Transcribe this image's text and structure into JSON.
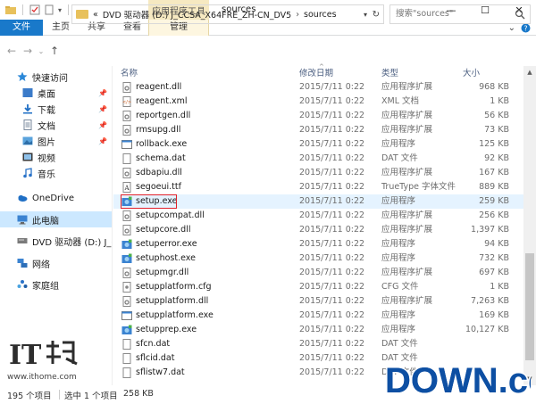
{
  "titlebar": {
    "context_group": "应用程序工具",
    "title": "sources",
    "minimize": "—",
    "maximize": "☐",
    "close": "✕"
  },
  "tabs": {
    "file": "文件",
    "home": "主页",
    "share": "共享",
    "view": "查看",
    "manage": "管理"
  },
  "address": {
    "overflow": "«",
    "path": [
      "DVD 驱动器 (D:) J_CCSA_X64FRE_ZH-CN_DV5",
      "sources"
    ],
    "search_placeholder": "搜索\"sources\""
  },
  "navpane": {
    "items": [
      {
        "label": "快速访问",
        "icon": "star-icon"
      },
      {
        "label": "桌面",
        "icon": "desktop-icon",
        "pinned": true
      },
      {
        "label": "下载",
        "icon": "download-icon",
        "pinned": true
      },
      {
        "label": "文档",
        "icon": "documents-icon",
        "pinned": true
      },
      {
        "label": "图片",
        "icon": "pictures-icon",
        "pinned": true
      },
      {
        "label": "视频",
        "icon": "videos-icon"
      },
      {
        "label": "音乐",
        "icon": "music-icon"
      },
      {
        "label": "OneDrive",
        "icon": "onedrive-icon"
      },
      {
        "label": "此电脑",
        "icon": "this-pc-icon",
        "selected": true
      },
      {
        "label": "DVD 驱动器 (D:) J_C",
        "icon": "dvd-drive-icon"
      },
      {
        "label": "网络",
        "icon": "network-icon"
      },
      {
        "label": "家庭组",
        "icon": "homegroup-icon"
      }
    ]
  },
  "columns": {
    "name": "名称",
    "date": "修改日期",
    "type": "类型",
    "size": "大小"
  },
  "files": [
    {
      "name": "reagent.dll",
      "date": "2015/7/11 0:22",
      "type": "应用程序扩展",
      "size": "968 KB",
      "icon": "dll-icon"
    },
    {
      "name": "reagent.xml",
      "date": "2015/7/11 0:22",
      "type": "XML 文档",
      "size": "1 KB",
      "icon": "xml-icon"
    },
    {
      "name": "reportgen.dll",
      "date": "2015/7/11 0:22",
      "type": "应用程序扩展",
      "size": "56 KB",
      "icon": "dll-icon"
    },
    {
      "name": "rmsupg.dll",
      "date": "2015/7/11 0:22",
      "type": "应用程序扩展",
      "size": "73 KB",
      "icon": "dll-icon"
    },
    {
      "name": "rollback.exe",
      "date": "2015/7/11 0:22",
      "type": "应用程序",
      "size": "125 KB",
      "icon": "exe-icon"
    },
    {
      "name": "schema.dat",
      "date": "2015/7/11 0:22",
      "type": "DAT 文件",
      "size": "92 KB",
      "icon": "dat-icon"
    },
    {
      "name": "sdbapiu.dll",
      "date": "2015/7/11 0:22",
      "type": "应用程序扩展",
      "size": "167 KB",
      "icon": "dll-icon"
    },
    {
      "name": "segoeui.ttf",
      "date": "2015/7/11 0:22",
      "type": "TrueType 字体文件",
      "size": "889 KB",
      "icon": "font-icon"
    },
    {
      "name": "setup.exe",
      "date": "2015/7/11 0:22",
      "type": "应用程序",
      "size": "259 KB",
      "icon": "setup-icon",
      "highlight": true
    },
    {
      "name": "setupcompat.dll",
      "date": "2015/7/11 0:22",
      "type": "应用程序扩展",
      "size": "256 KB",
      "icon": "dll-icon"
    },
    {
      "name": "setupcore.dll",
      "date": "2015/7/11 0:22",
      "type": "应用程序扩展",
      "size": "1,397 KB",
      "icon": "dll-icon"
    },
    {
      "name": "setuperror.exe",
      "date": "2015/7/11 0:22",
      "type": "应用程序",
      "size": "94 KB",
      "icon": "setup-icon"
    },
    {
      "name": "setuphost.exe",
      "date": "2015/7/11 0:22",
      "type": "应用程序",
      "size": "732 KB",
      "icon": "setup-icon"
    },
    {
      "name": "setupmgr.dll",
      "date": "2015/7/11 0:22",
      "type": "应用程序扩展",
      "size": "697 KB",
      "icon": "dll-icon"
    },
    {
      "name": "setupplatform.cfg",
      "date": "2015/7/11 0:22",
      "type": "CFG 文件",
      "size": "1 KB",
      "icon": "cfg-icon"
    },
    {
      "name": "setupplatform.dll",
      "date": "2015/7/11 0:22",
      "type": "应用程序扩展",
      "size": "7,263 KB",
      "icon": "dll-icon"
    },
    {
      "name": "setupplatform.exe",
      "date": "2015/7/11 0:22",
      "type": "应用程序",
      "size": "169 KB",
      "icon": "exe-icon"
    },
    {
      "name": "setupprep.exe",
      "date": "2015/7/11 0:22",
      "type": "应用程序",
      "size": "10,127 KB",
      "icon": "setup-icon"
    },
    {
      "name": "sfcn.dat",
      "date": "2015/7/11 0:22",
      "type": "DAT 文件",
      "size": "",
      "icon": "dat-icon"
    },
    {
      "name": "sflcid.dat",
      "date": "2015/7/11 0:22",
      "type": "DAT 文件",
      "size": "",
      "icon": "dat-icon"
    },
    {
      "name": "sflistw7.dat",
      "date": "2015/7/11 0:22",
      "type": "DAT 文件",
      "size": "",
      "icon": "dat-icon"
    }
  ],
  "status": {
    "count": "195 个项目",
    "selected": "选中 1 个项目",
    "size": "258 KB"
  },
  "watermarks": {
    "ithome_logo": "IT之家",
    "ithome_url": "www.ithome.com",
    "down_logo": "DOWN.cc"
  },
  "colors": {
    "file_tab": "#1979ca",
    "selection": "#cce8ff",
    "highlight_box": "#e0202a",
    "context_group": "#f6e9c1"
  }
}
